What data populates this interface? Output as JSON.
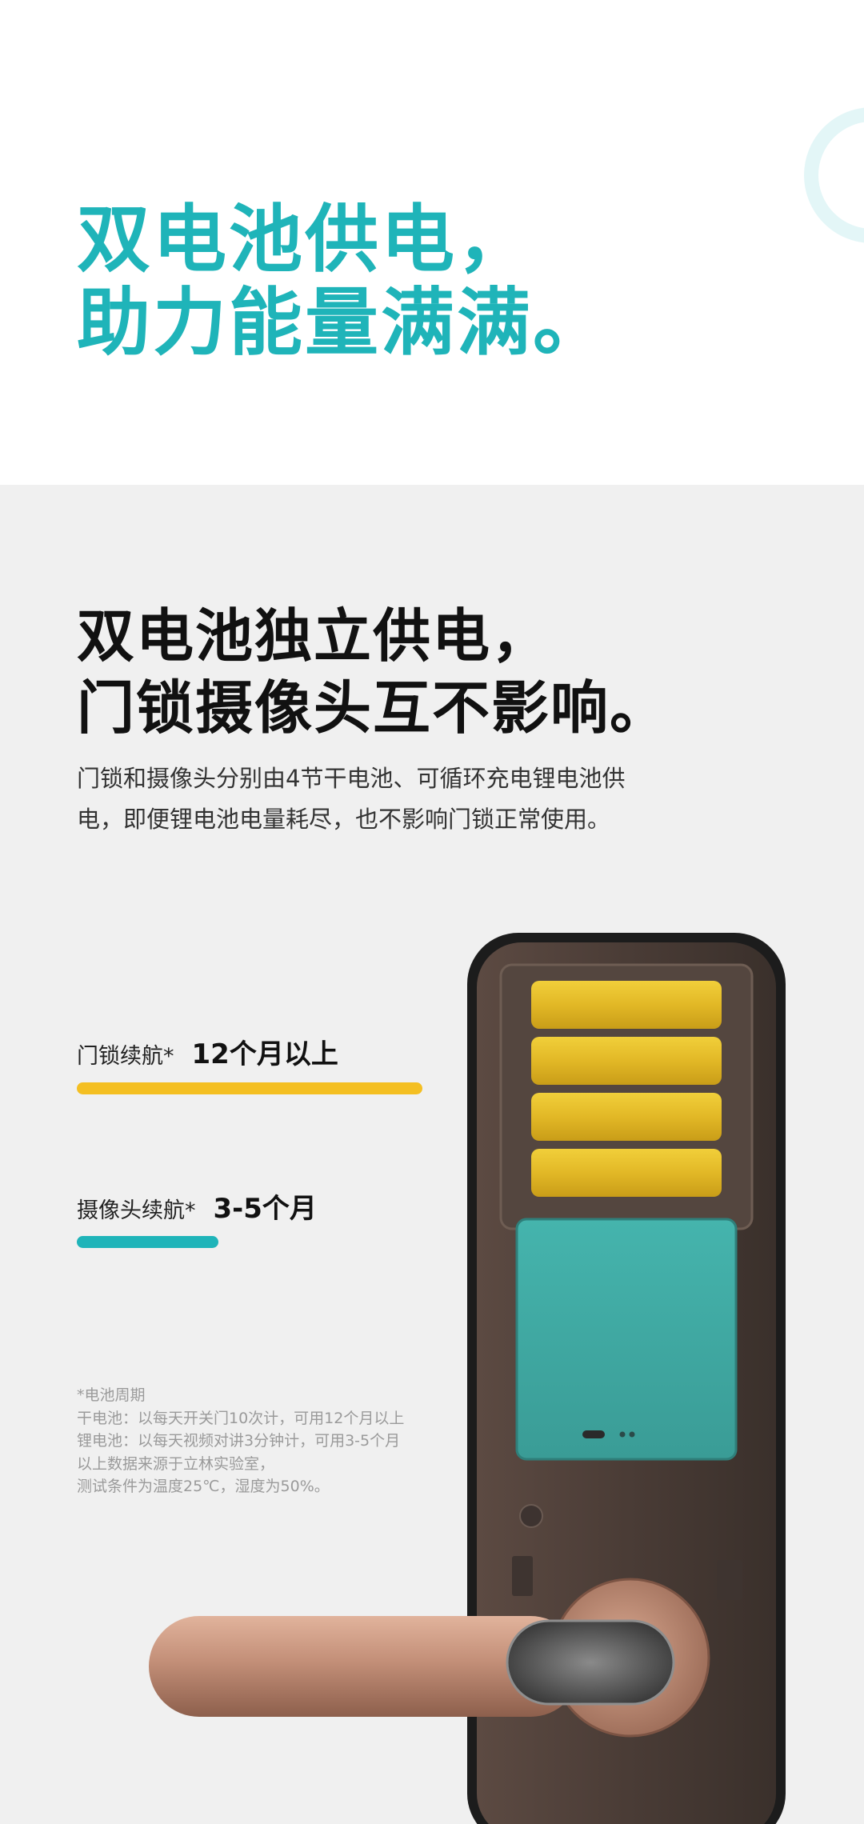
{
  "hero": {
    "title": "双电池供电，\n助力能量满满。"
  },
  "section": {
    "title": "双电池独立供电，\n门锁摄像头互不影响。",
    "description": "门锁和摄像头分别由4节干电池、可循环充电锂电池供\n电，即便锂电池电量耗尽，也不影响门锁正常使用。"
  },
  "stats": [
    {
      "label": "门锁续航*",
      "value": "12个月以上",
      "bar_color": "#f4bf22",
      "bar_fraction": 1.0
    },
    {
      "label": "摄像头续航*",
      "value": "3-5个月",
      "bar_color": "#1fb4b9",
      "bar_fraction": 0.41
    }
  ],
  "footnote": "*电池周期\n干电池：以每天开关门10次计，可用12个月以上\n锂电池：以每天视频对讲3分钟计，可用3-5个月\n以上数据来源于立林实验室，\n测试条件为温度25℃，湿度为50%。",
  "colors": {
    "accent": "#1fb4b9",
    "yellow": "#f4bf22",
    "battery_teal": "#3fa9a3",
    "copper": "#c38f78"
  }
}
